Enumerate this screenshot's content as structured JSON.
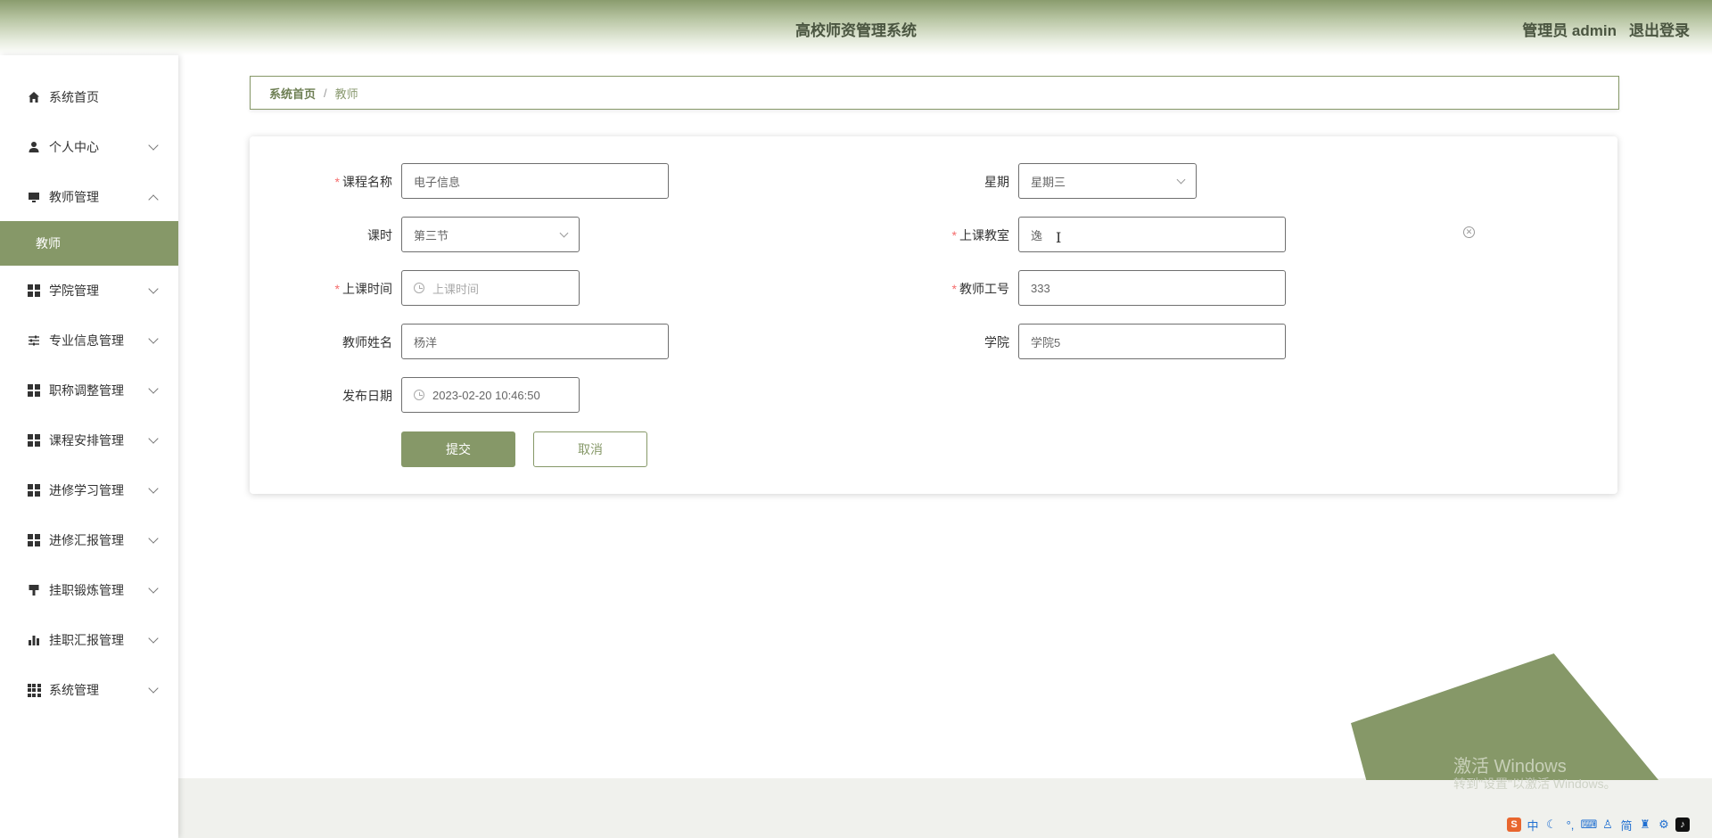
{
  "header": {
    "title": "高校师资管理系统",
    "user": "管理员 admin",
    "logout": "退出登录"
  },
  "sidebar": {
    "items": [
      {
        "label": "系统首页",
        "icon": "home-icon"
      },
      {
        "label": "个人中心",
        "icon": "user-icon"
      },
      {
        "label": "教师管理",
        "icon": "monitor-icon"
      },
      {
        "label": "学院管理",
        "icon": "grid-icon"
      },
      {
        "label": "专业信息管理",
        "icon": "sliders-icon"
      },
      {
        "label": "职称调整管理",
        "icon": "grid-icon"
      },
      {
        "label": "课程安排管理",
        "icon": "grid-icon"
      },
      {
        "label": "进修学习管理",
        "icon": "grid-icon"
      },
      {
        "label": "进修汇报管理",
        "icon": "grid-icon"
      },
      {
        "label": "挂职锻炼管理",
        "icon": "brush-icon"
      },
      {
        "label": "挂职汇报管理",
        "icon": "bar-chart-icon"
      },
      {
        "label": "系统管理",
        "icon": "apps-icon"
      }
    ],
    "sub_item": "教师"
  },
  "breadcrumb": {
    "home": "系统首页",
    "separator": "/",
    "current": "教师"
  },
  "form": {
    "course_name": {
      "label": "课程名称",
      "value": "电子信息"
    },
    "weekday": {
      "label": "星期",
      "value": "星期三"
    },
    "period": {
      "label": "课时",
      "value": "第三节"
    },
    "classroom": {
      "label": "上课教室",
      "value": "逸"
    },
    "class_time": {
      "label": "上课时间",
      "placeholder": "上课时间"
    },
    "teacher_id": {
      "label": "教师工号",
      "value": "333"
    },
    "teacher_name": {
      "label": "教师姓名",
      "value": "杨洋"
    },
    "college": {
      "label": "学院",
      "value": "学院5"
    },
    "publish_date": {
      "label": "发布日期",
      "value": "2023-02-20 10:46:50"
    },
    "required_mark": "*",
    "submit": "提交",
    "cancel": "取消"
  },
  "watermark": {
    "line1": "激活 Windows",
    "line2": "转到\"设置\"以激活 Windows。"
  },
  "tray": {
    "ime_lang": "中",
    "ime_mode": "简"
  },
  "colors": {
    "accent": "#869868",
    "required": "#f56c6c"
  }
}
